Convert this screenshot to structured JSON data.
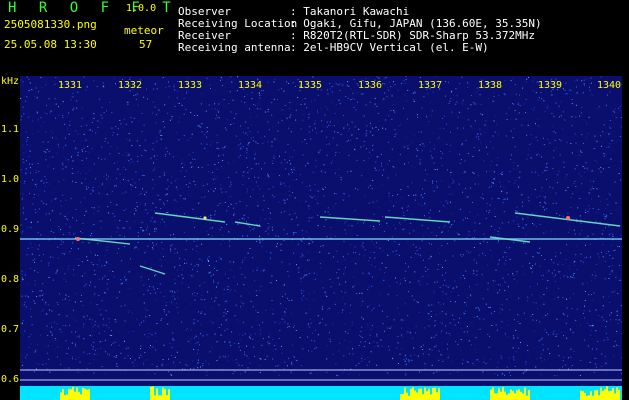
{
  "header": {
    "app_name": "H R O F F T",
    "version": "1.0.0",
    "filename": "2505081330.png",
    "datetime": "25.05.08 13:30",
    "meteor_label": "meteor",
    "meteor_count": "57",
    "fields": [
      {
        "label": "Observer",
        "value": ": Takanori Kawachi"
      },
      {
        "label": "Receiving Location",
        "value": ": Ogaki, Gifu, JAPAN (136.60E, 35.35N)"
      },
      {
        "label": "Receiver",
        "value": ": R820T2(RTL-SDR) SDR-Sharp 53.372MHz"
      },
      {
        "label": "Receiving antenna",
        "value": ": 2el-HB9CV Vertical (el. E-W)"
      }
    ]
  },
  "axes": {
    "y_unit": "kHz",
    "y_ticks": [
      "1.1",
      "1.0",
      "0.9",
      "0.8",
      "0.7",
      "0.6"
    ],
    "x_ticks": [
      "1331",
      "1332",
      "1333",
      "1334",
      "1335",
      "1336",
      "1337",
      "1338",
      "1339",
      "1340"
    ]
  },
  "colors": {
    "background": "#000000",
    "spectrogram_base": "#0a0f6e",
    "axis_text": "#ffff00",
    "brand": "#33ff33",
    "carrier": "#7fd8ff",
    "noise_bar": "#00e5ff",
    "noise_peak": "#ffff00"
  }
}
